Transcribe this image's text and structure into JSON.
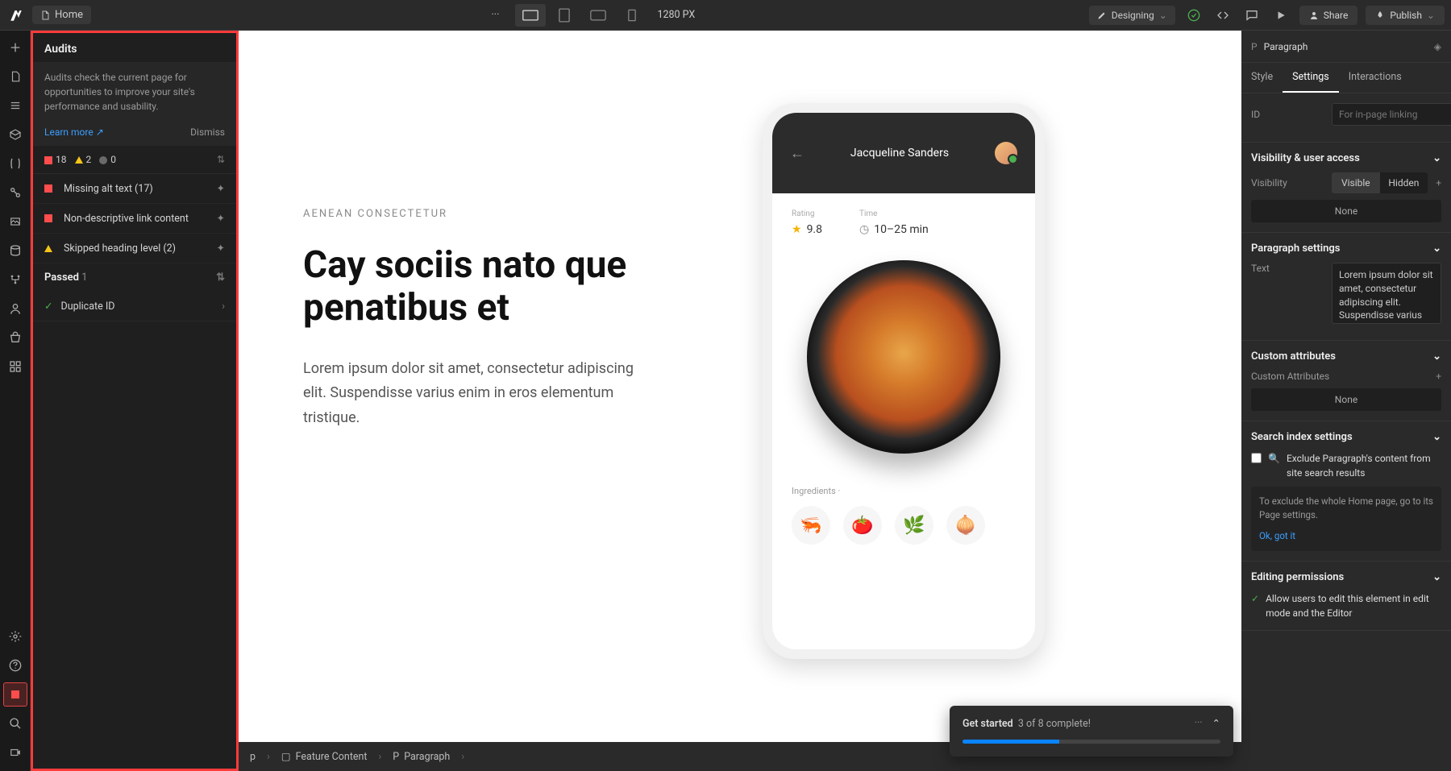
{
  "topbar": {
    "page_label": "Home",
    "viewport_width": "1280 PX",
    "mode_label": "Designing",
    "share_label": "Share",
    "publish_label": "Publish"
  },
  "audits": {
    "title": "Audits",
    "description": "Audits check the current page for opportunities to improve your site's performance and usability.",
    "learn_more": "Learn more",
    "dismiss": "Dismiss",
    "count_error": "18",
    "count_warn": "2",
    "count_info": "0",
    "items": [
      {
        "label": "Missing alt text (17)",
        "severity": "error"
      },
      {
        "label": "Non-descriptive link content",
        "severity": "error"
      },
      {
        "label": "Skipped heading level (2)",
        "severity": "warn"
      }
    ],
    "passed_label": "Passed",
    "passed_count": "1",
    "passed_items": [
      {
        "label": "Duplicate ID"
      }
    ]
  },
  "canvas": {
    "eyebrow": "AENEAN CONSECTETUR",
    "headline": "Cay sociis nato que penatibus et",
    "body": "Lorem ipsum dolor sit amet, consectetur adipiscing elit. Suspendisse varius enim in eros elementum tristique.",
    "phone": {
      "name": "Jacqueline Sanders",
      "rating_label": "Rating",
      "rating_value": "9.8",
      "time_label": "Time",
      "time_value": "10–25 min",
      "ingredients_label": "Ingredients ·"
    }
  },
  "breadcrumbs": [
    {
      "icon": "p",
      "label": "p"
    },
    {
      "icon": "section",
      "label": "Feature Content"
    },
    {
      "icon": "P",
      "label": "Paragraph"
    }
  ],
  "right": {
    "selected": "Paragraph",
    "tabs": [
      "Style",
      "Settings",
      "Interactions"
    ],
    "active_tab": "Settings",
    "id_label": "ID",
    "id_placeholder": "For in-page linking",
    "visibility": {
      "title": "Visibility & user access",
      "label": "Visibility",
      "visible": "Visible",
      "hidden": "Hidden",
      "none": "None"
    },
    "paragraph": {
      "title": "Paragraph settings",
      "label": "Text",
      "value": "Lorem ipsum dolor sit amet, consectetur adipiscing elit. Suspendisse varius enim in eros elementum tristique."
    },
    "custom_attrs": {
      "title": "Custom attributes",
      "label": "Custom Attributes",
      "none": "None"
    },
    "search_index": {
      "title": "Search index settings",
      "checkbox_label": "Exclude Paragraph's content from site search results",
      "info": "To exclude the whole Home page, go to its Page settings.",
      "ok": "Ok, got it"
    },
    "editing": {
      "title": "Editing permissions",
      "label": "Allow users to edit this element in edit mode and the Editor"
    }
  },
  "toast": {
    "title": "Get started",
    "status": "3 of 8 complete!"
  }
}
